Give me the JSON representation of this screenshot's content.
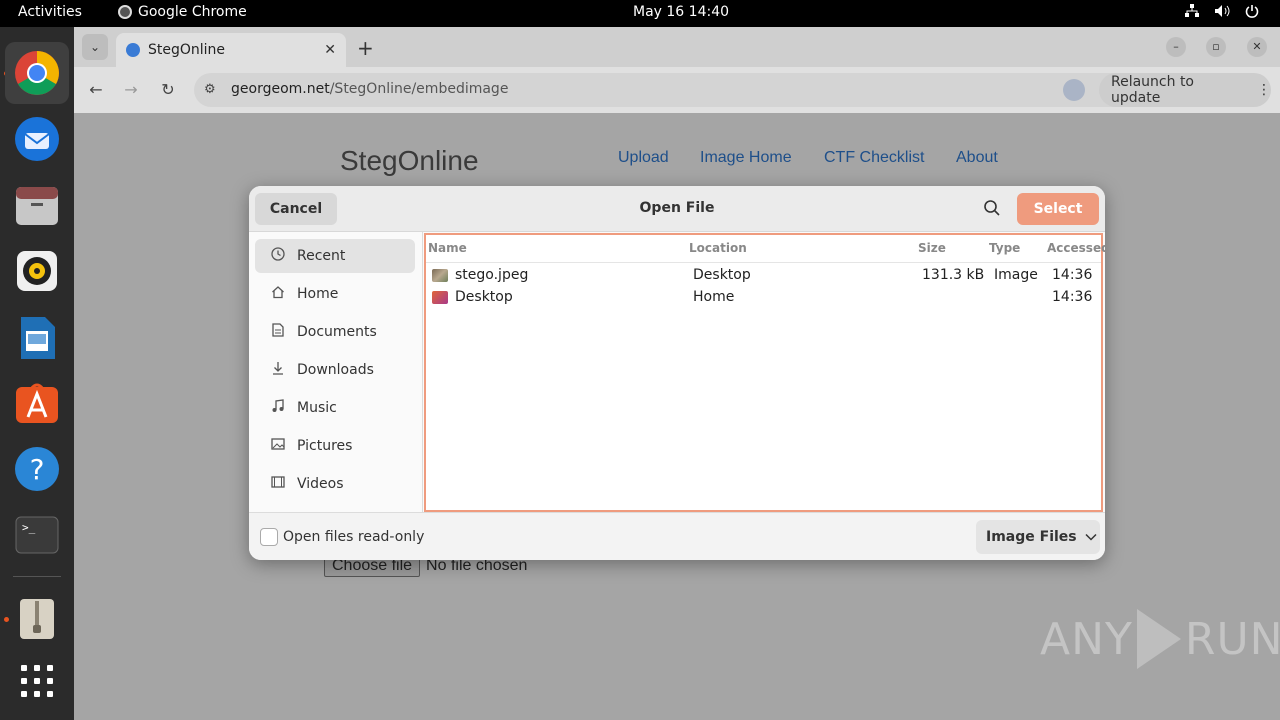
{
  "topbar": {
    "activities": "Activities",
    "app_name": "Google Chrome",
    "clock": "May 16  14:40",
    "tray_icons": [
      "network-icon",
      "volume-icon",
      "power-icon"
    ]
  },
  "dock": {
    "apps": [
      "chrome",
      "thunderbird",
      "files",
      "rhythmbox",
      "writer",
      "app-center",
      "help",
      "terminal",
      "archive-manager",
      "show-apps"
    ]
  },
  "browser": {
    "tab_title": "StegOnline",
    "url_host": "georgeom.net",
    "url_path": "/StegOnline/embedimage",
    "relaunch_label": "Relaunch to update"
  },
  "page": {
    "brand": "StegOnline",
    "nav": [
      "Upload",
      "Image Home",
      "CTF Checklist",
      "About"
    ],
    "choose_file_label": "Choose file",
    "no_file_text": "No file chosen",
    "watermark_left": "ANY",
    "watermark_right": "RUN"
  },
  "dialog": {
    "title": "Open File",
    "cancel_label": "Cancel",
    "select_label": "Select",
    "places": [
      {
        "label": "Recent",
        "icon": "clock-icon"
      },
      {
        "label": "Home",
        "icon": "home-icon"
      },
      {
        "label": "Documents",
        "icon": "document-icon"
      },
      {
        "label": "Downloads",
        "icon": "download-icon"
      },
      {
        "label": "Music",
        "icon": "music-icon"
      },
      {
        "label": "Pictures",
        "icon": "picture-icon"
      },
      {
        "label": "Videos",
        "icon": "video-icon"
      }
    ],
    "columns": {
      "name": "Name",
      "location": "Location",
      "size": "Size",
      "type": "Type",
      "accessed": "Accessed"
    },
    "files": [
      {
        "name": "stego.jpeg",
        "location": "Desktop",
        "size": "131.3 kB",
        "type": "Image",
        "accessed": "14:36"
      },
      {
        "name": "Desktop",
        "location": "Home",
        "size": "",
        "type": "",
        "accessed": "14:36"
      }
    ],
    "readonly_label": "Open files read-only",
    "filter_label": "Image Files"
  },
  "colors": {
    "accent": "#ef9b7e",
    "link": "#1e4f8a"
  }
}
